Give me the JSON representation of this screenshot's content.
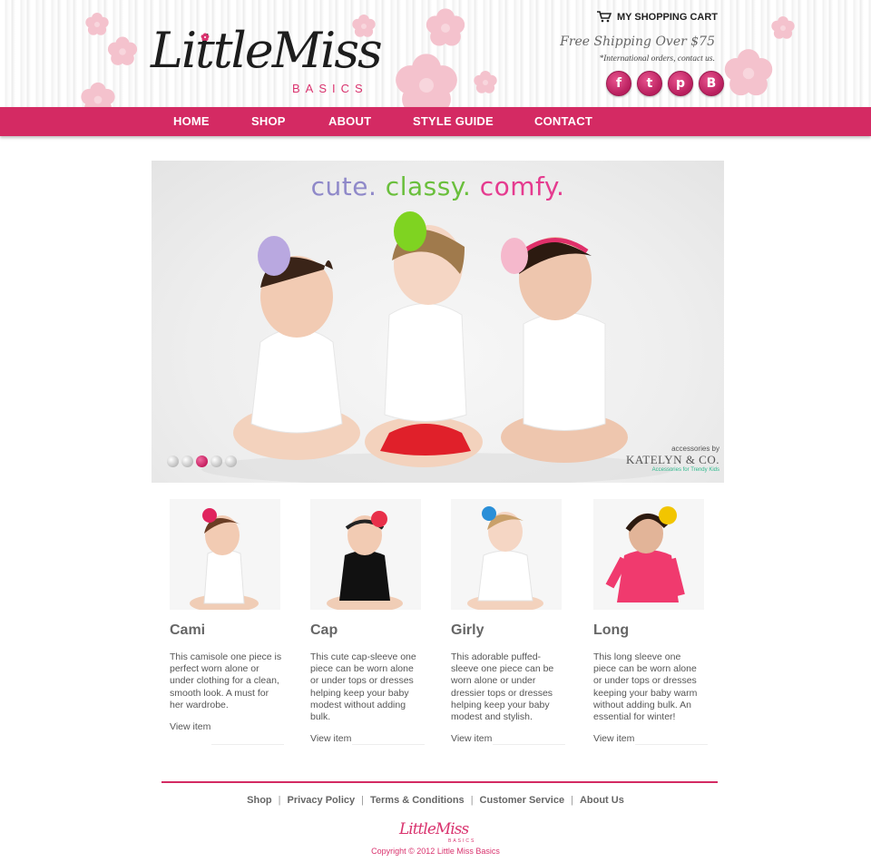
{
  "brand": {
    "logo_script": "LittleMiss",
    "logo_sub": "BASICS"
  },
  "header": {
    "cart_label": "MY SHOPPING CART",
    "shipping_text": "Free Shipping Over $75",
    "international_text": "*International orders, contact us.",
    "social": [
      {
        "icon": "facebook-icon",
        "glyph": "f"
      },
      {
        "icon": "twitter-icon",
        "glyph": "t"
      },
      {
        "icon": "pinterest-icon",
        "glyph": "p"
      },
      {
        "icon": "blogger-icon",
        "glyph": "B"
      }
    ]
  },
  "nav": {
    "items": [
      "HOME",
      "SHOP",
      "ABOUT",
      "STYLE GUIDE",
      "CONTACT"
    ]
  },
  "hero": {
    "tagline_1": "cute.",
    "tagline_2": "classy.",
    "tagline_3": "comfy.",
    "slides_total": 5,
    "active_slide": 3,
    "credit_small": "accessories by",
    "credit_brand": "KATELYN & CO.",
    "credit_sub": "Accessories for Trendy Kids"
  },
  "products": [
    {
      "title": "Cami",
      "description": "This camisole one piece is perfect worn alone or under clothing for a clean, smooth look. A must for her wardrobe.",
      "link": "View item",
      "accent": "#e0245e",
      "outfit": "#ffffff"
    },
    {
      "title": "Cap",
      "description": "This cute cap-sleeve one piece can be worn alone or under tops or dresses helping keep your baby modest without adding bulk.",
      "link": "View item",
      "accent": "#e8304a",
      "outfit": "#111111"
    },
    {
      "title": "Girly",
      "description": "This adorable puffed-sleeve one piece can be worn alone or under dressier tops or dresses helping keep your baby modest and stylish.",
      "link": "View item",
      "accent": "#2a8fd8",
      "outfit": "#ffffff"
    },
    {
      "title": "Long",
      "description": "This long sleeve one piece can be worn alone or under tops or dresses keeping your baby warm without adding bulk. An essential for winter!",
      "link": "View item",
      "accent": "#f2c500",
      "outfit": "#f03a6e"
    }
  ],
  "footer": {
    "links": [
      "Shop",
      "Privacy Policy",
      "Terms & Conditions",
      "Customer Service",
      "About Us"
    ],
    "logo_script": "LittleMiss",
    "logo_sub": "BASICS",
    "copyright": "Copyright © 2012 Little Miss Basics"
  },
  "colors": {
    "brand_pink": "#d42a63",
    "flower_pink": "#f4c2cd"
  }
}
